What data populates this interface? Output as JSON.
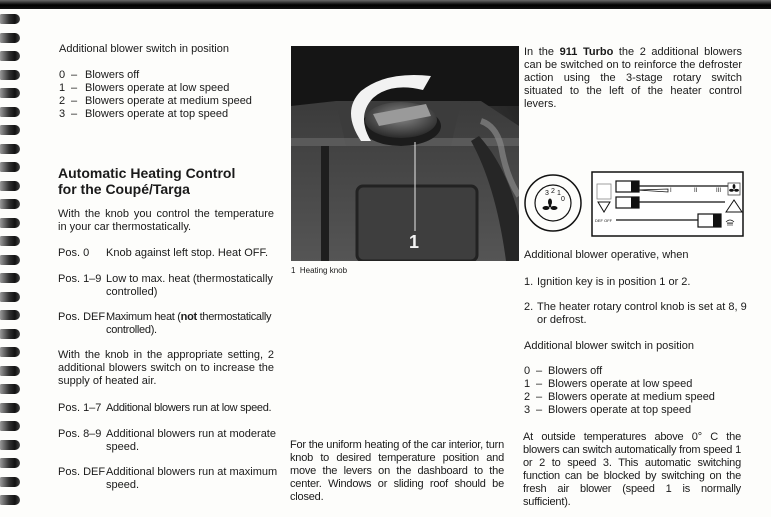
{
  "col1": {
    "intro": "Additional blower switch in position",
    "positions": [
      {
        "num": "0",
        "dash": "–",
        "text": "Blowers off"
      },
      {
        "num": "1",
        "dash": "–",
        "text": "Blowers operate at low speed"
      },
      {
        "num": "2",
        "dash": "–",
        "text": "Blowers operate at medium speed"
      },
      {
        "num": "3",
        "dash": "–",
        "text": "Blowers operate at top speed"
      }
    ],
    "heading_line1": "Automatic Heating Control",
    "heading_line2": "for the Coupé/Targa",
    "para1": "With the knob you control the temperature in your car thermostatically.",
    "settings": [
      {
        "label": "Pos. 0",
        "text": "Knob against left stop. Heat OFF."
      },
      {
        "label": "Pos. 1–9",
        "text": "Low to max. heat (thermostatically controlled)"
      },
      {
        "label": "Pos. DEF",
        "text_pre": "Maximum heat (",
        "text_bold": "not",
        "text_post": " thermostatically controlled)."
      }
    ],
    "para2": "With the knob in the appropriate setting, 2 additional blowers switch on to increase the supply of heated air.",
    "blower_settings": [
      {
        "label": "Pos. 1–7",
        "text": "Additional blowers run at low speed."
      },
      {
        "label": "Pos. 8–9",
        "text": "Additional blowers run at moderate speed."
      },
      {
        "label": "Pos. DEF",
        "text": "Additional blowers run at maximum speed."
      }
    ]
  },
  "col2": {
    "figure_callout": "1",
    "caption_num": "1",
    "caption_text": "Heating knob",
    "para": "For the uniform heating of the car interior, turn knob to desired temperature position and move the levers on the dashboard to the center. Windows or sliding roof should be closed."
  },
  "col3": {
    "para1_pre": "In the ",
    "para1_bold": "911 Turbo",
    "para1_post": " the 2 additional blowers can be switched on to reinforce the defroster action using the 3-stage rotary switch situated to the left of the heater control levers.",
    "diagram": {
      "dial_labels": [
        "3",
        "2",
        "1",
        "0"
      ],
      "scale_labels": [
        "I",
        "II",
        "III"
      ],
      "small_label": "DEF OFF"
    },
    "operative_intro": "Additional blower operative, when",
    "conditions": [
      {
        "num": "1.",
        "text": "Ignition key is in position 1 or 2."
      },
      {
        "num": "2.",
        "text": "The heater rotary control knob is set at 8, 9 or defrost."
      }
    ],
    "intro": "Additional blower switch in position",
    "positions": [
      {
        "num": "0",
        "dash": "–",
        "text": "Blowers off"
      },
      {
        "num": "1",
        "dash": "–",
        "text": "Blowers operate at low speed"
      },
      {
        "num": "2",
        "dash": "–",
        "text": "Blowers operate at medium speed"
      },
      {
        "num": "3",
        "dash": "–",
        "text": "Blowers operate at top speed"
      }
    ],
    "para_final": "At outside temperatures above 0° C the blowers can switch automatically from speed 1 or 2 to speed 3. This automatic switching function can be blocked by switching on the fresh air blower (speed 1 is normally sufficient)."
  }
}
